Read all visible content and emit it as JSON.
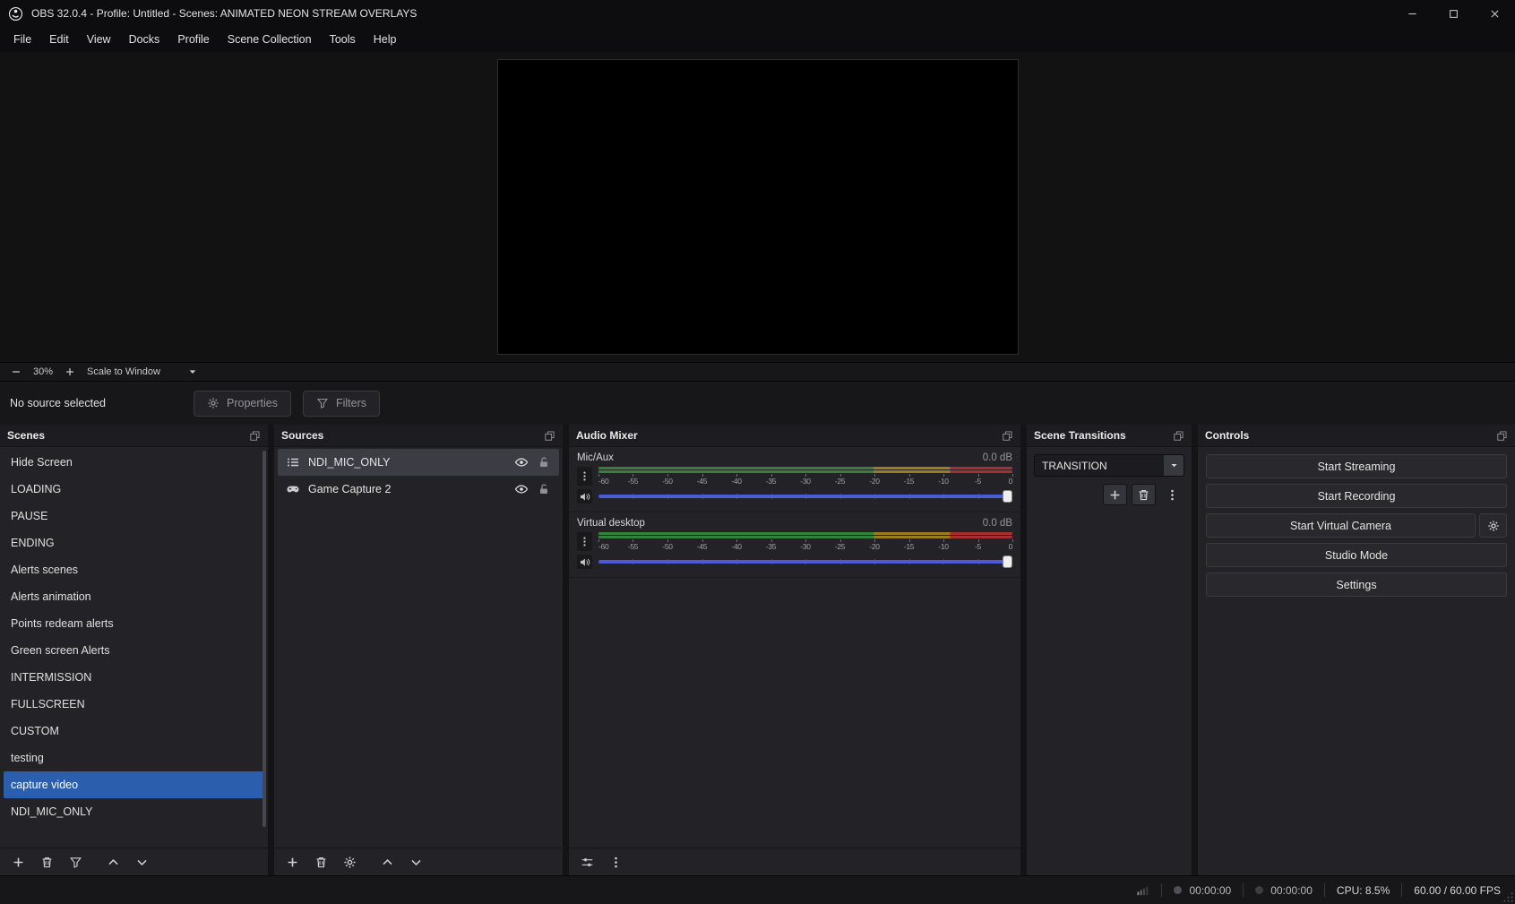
{
  "titlebar": {
    "title": "OBS 32.0.4 - Profile: Untitled - Scenes: ANIMATED NEON STREAM OVERLAYS"
  },
  "menu": {
    "items": [
      "File",
      "Edit",
      "View",
      "Docks",
      "Profile",
      "Scene Collection",
      "Tools",
      "Help"
    ]
  },
  "preview": {
    "zoom": "30%",
    "scale_mode": "Scale to Window"
  },
  "source_toolbar": {
    "status": "No source selected",
    "properties_label": "Properties",
    "filters_label": "Filters"
  },
  "scenes": {
    "title": "Scenes",
    "items": [
      {
        "label": "Hide Screen",
        "selected": false
      },
      {
        "label": "LOADING",
        "selected": false
      },
      {
        "label": "PAUSE",
        "selected": false
      },
      {
        "label": "ENDING",
        "selected": false
      },
      {
        "label": "Alerts scenes",
        "selected": false
      },
      {
        "label": "Alerts animation",
        "selected": false
      },
      {
        "label": "Points redeam alerts",
        "selected": false
      },
      {
        "label": "Green screen Alerts",
        "selected": false
      },
      {
        "label": "INTERMISSION",
        "selected": false
      },
      {
        "label": "FULLSCREEN",
        "selected": false
      },
      {
        "label": "CUSTOM",
        "selected": false
      },
      {
        "label": "testing",
        "selected": false
      },
      {
        "label": "capture video",
        "selected": true
      },
      {
        "label": "NDI_MIC_ONLY",
        "selected": false
      }
    ],
    "toolbar": [
      "add",
      "remove",
      "filters",
      "move-up",
      "move-down"
    ]
  },
  "sources": {
    "title": "Sources",
    "items": [
      {
        "label": "NDI_MIC_ONLY",
        "icon": "list",
        "selected": true,
        "visible": true,
        "locked": false
      },
      {
        "label": "Game Capture 2",
        "icon": "gamepad",
        "selected": false,
        "visible": true,
        "locked": false
      }
    ],
    "toolbar": [
      "add",
      "remove",
      "properties",
      "move-up",
      "move-down"
    ]
  },
  "audio_mixer": {
    "title": "Audio Mixer",
    "scale_labels": [
      "-60",
      "-55",
      "-50",
      "-45",
      "-40",
      "-35",
      "-30",
      "-25",
      "-20",
      "-15",
      "-10",
      "-5",
      "0"
    ],
    "channels": [
      {
        "name": "Mic/Aux",
        "level": "0.0 dB",
        "volume_percent": 100
      },
      {
        "name": "Virtual desktop",
        "level": "0.0 dB",
        "volume_percent": 100
      }
    ],
    "toolbar": [
      "advanced-audio",
      "more"
    ]
  },
  "transitions": {
    "title": "Scene Transitions",
    "selected": "TRANSITION",
    "toolbar": [
      "add",
      "remove",
      "more"
    ]
  },
  "controls": {
    "title": "Controls",
    "buttons": [
      {
        "label": "Start Streaming"
      },
      {
        "label": "Start Recording"
      },
      {
        "label": "Start Virtual Camera",
        "config": true
      },
      {
        "label": "Studio Mode"
      },
      {
        "label": "Settings"
      }
    ]
  },
  "statusbar": {
    "recording_time": "00:00:00",
    "streaming_time": "00:00:00",
    "cpu": "CPU: 8.5%",
    "fps": "60.00 / 60.00 FPS"
  },
  "colors": {
    "selection_blue": "#2b5fae",
    "slider_blue": "#4a5bd4",
    "meter_green": "#35803a",
    "meter_yellow": "#9c7c20",
    "meter_red": "#a82f2f"
  }
}
